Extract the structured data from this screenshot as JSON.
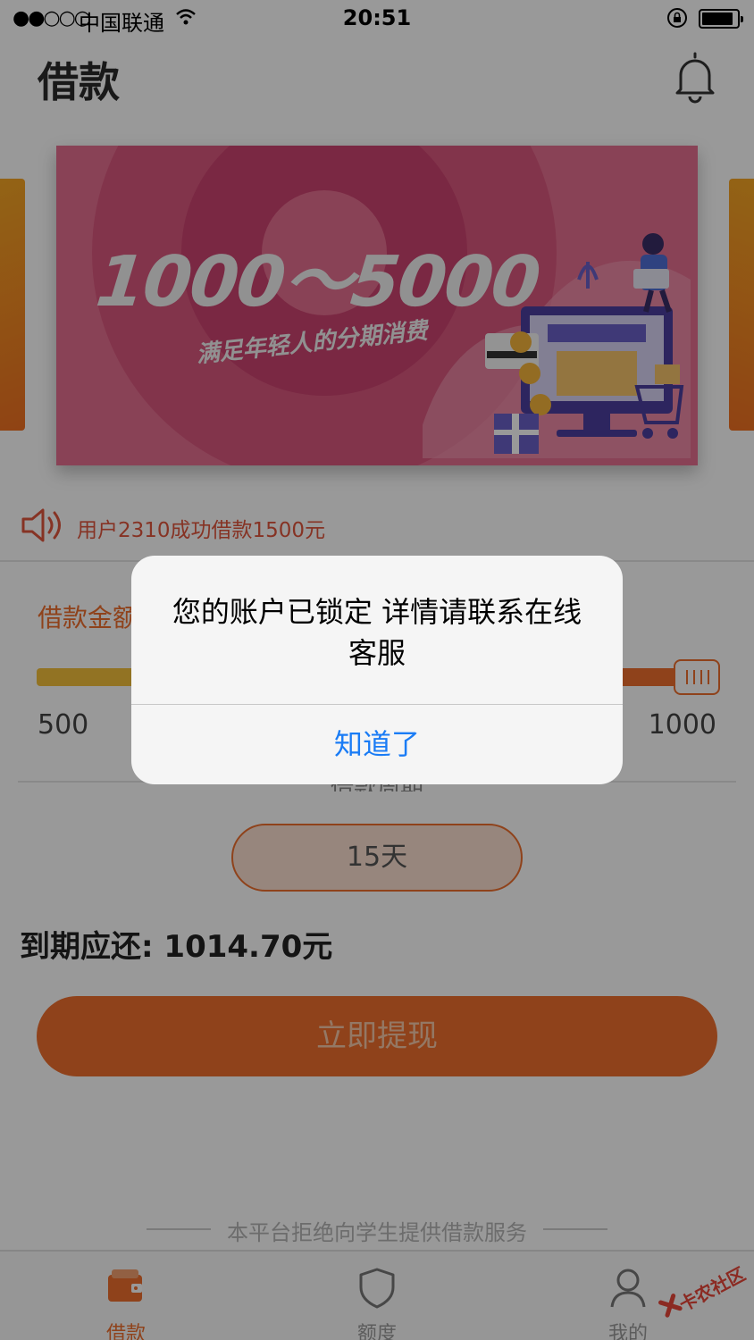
{
  "status_bar": {
    "signal": "●●○○○",
    "carrier": "中国联通",
    "time": "20:51"
  },
  "header": {
    "title": "借款"
  },
  "banner": {
    "headline": "1000～5000",
    "subline": "满足年轻人的分期消费"
  },
  "notice": {
    "text": "用户2310成功借款1500元"
  },
  "loan": {
    "amount_label": "借款金额",
    "slider_min": "500",
    "slider_max": "1000",
    "slider_value_fraction": 1.0,
    "term_label": "借款周期",
    "term_value": "15天",
    "due_text": "到期应还: 1014.70元",
    "withdraw_label": "立即提现"
  },
  "footer": {
    "note": "本平台拒绝向学生提供借款服务"
  },
  "tabbar": {
    "items": [
      {
        "label": "借款"
      },
      {
        "label": "额度"
      },
      {
        "label": "我的"
      }
    ]
  },
  "watermark": {
    "text": "卡农社区"
  },
  "alert": {
    "message": "您的账户已锁定 详情请联系在线客服",
    "button": "知道了"
  },
  "colors": {
    "accent": "#ee6f2d",
    "link_blue": "#1a7cf5"
  }
}
